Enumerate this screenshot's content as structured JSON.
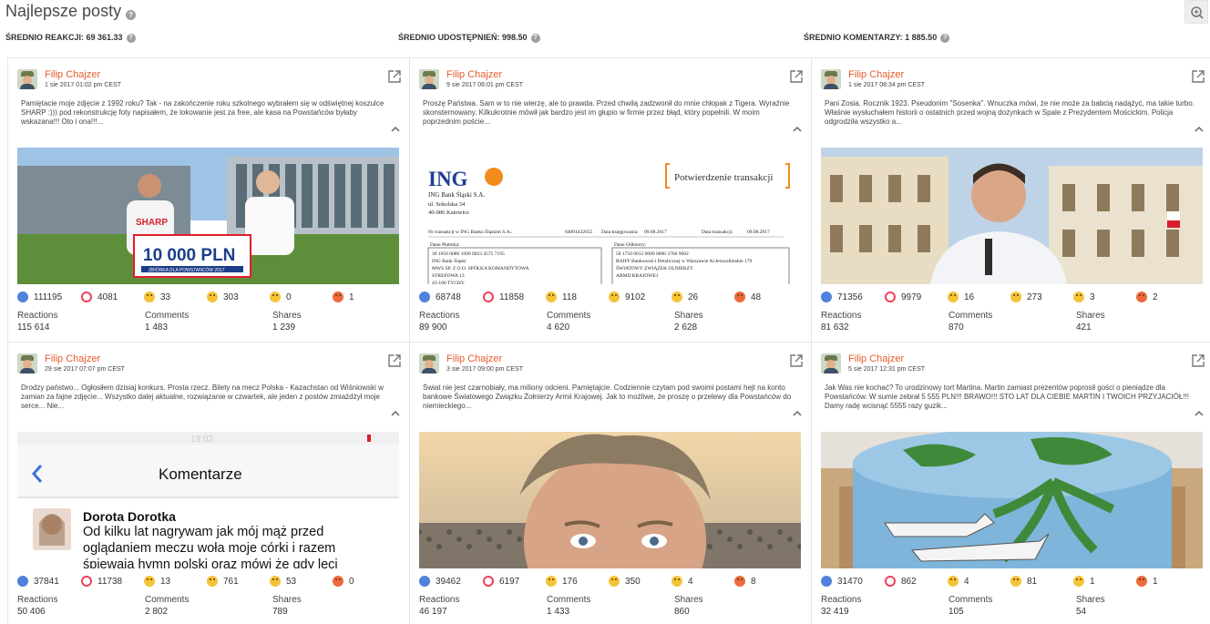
{
  "header": {
    "title": "Najlepsze posty"
  },
  "stats": {
    "avg_reactions": "ŚREDNIO REAKCJI: 69 361.33",
    "avg_shares": "ŚREDNIO UDOSTĘPNIEŃ: 998.50",
    "avg_comments": "ŚREDNIO KOMENTARZY: 1 885.50"
  },
  "labels": {
    "reactions": "Reactions",
    "comments": "Comments",
    "shares": "Shares"
  },
  "posts": [
    {
      "author": "Filip Chajzer",
      "date": "1 sie 2017 01:02 pm CEST",
      "text": "Pamiętacie moje zdjęcie z 1992 roku? Tak - na zakończenie roku szkolnego wybrałem się w odświętnej koszulce SHARP :))) pod rekonstrukcję foty napisałem, że lokowanie jest za free, ale kasa na Powstańców byłaby wskazana!!! Oto i ona!!!...",
      "media": "photo-check",
      "photo_text": {
        "brand": "SHARP",
        "amount": "10 000 PLN",
        "caption": "ZBIÓRKA DLA POWSTAŃCÓW 2017"
      },
      "reactions": {
        "like": "111195",
        "love": "4081",
        "haha": "33",
        "wow": "303",
        "sad": "0",
        "angry": "1"
      },
      "totals": {
        "reactions": "115 614",
        "comments": "1 483",
        "shares": "1 239"
      }
    },
    {
      "author": "Filip Chajzer",
      "date": "9 sie 2017 06:01 pm CEST",
      "text": "Proszę Państwa. Sam w to nie wierzę, ale to prawda. Przed chwilą zadzwonił do mnie chłopak z Tigera. Wyraźnie skonsternowany. Kilkukrotnie mówił jak bardzo jest im głupio w firmie przez błąd, który popełnili. W moim poprzednim poście...",
      "media": "document",
      "document": {
        "logo": "ING",
        "bank_name": "ING Bank Śląski S.A.",
        "address1": "ul. Sokolska 34",
        "address2": "40-086 Katowice",
        "heading": "Potwierdzenie transakcji",
        "line1": "Nr transakcji w ING Banku Śląskim S.A.:",
        "line1_val": "64001432655",
        "line1_date_label": "Data księgowania:",
        "line1_date": "09.08.2017",
        "line1_date2_label": "Data transakcji:",
        "line1_date2": "09.08.2017",
        "payer_label": "Dane Płatnika:",
        "payer_lines": [
          "39 1050 0086 1000 0023 4575 7195",
          "ING Bank Śląski",
          "MWS SP. Z O.O. SPÓŁKA KOMANDYTOWA",
          "STREFOWA 13",
          "43-100 TYCHY"
        ],
        "payee_label": "Dane Odbiorcy:",
        "payee_lines": [
          "50 1750 0012 0000 0000 3760 9692",
          "RAIFF Bankowości Detalicznej w Warszawie Al.Jerozolimskie 179",
          "ŚWIATOWY ZWIĄZEK    OLNIERZY",
          "ARMII KRAJOWEJ"
        ]
      },
      "reactions": {
        "like": "68748",
        "love": "11858",
        "haha": "118",
        "wow": "9102",
        "sad": "26",
        "angry": "48"
      },
      "totals": {
        "reactions": "89 900",
        "comments": "4 620",
        "shares": "2 628"
      }
    },
    {
      "author": "Filip Chajzer",
      "date": "1 sie 2017 08:34 pm CEST",
      "text": "Pani Zosia. Rocznik 1923. Pseudonim \"Sosenka\". Wnuczka mówi, że nie może za babcią nadążyć, ma takie turbo. Właśnie wysłuchałem historii o ostatnich przed wojną dożynkach w Spale z Prezydentem Mościckim. Policja odgrodziła wszystko a...",
      "media": "photo-palace",
      "reactions": {
        "like": "71356",
        "love": "9979",
        "haha": "16",
        "wow": "273",
        "sad": "3",
        "angry": "2"
      },
      "totals": {
        "reactions": "81 632",
        "comments": "870",
        "shares": "421"
      }
    },
    {
      "author": "Filip Chajzer",
      "date": "29 sie 2017 07:07 pm CEST",
      "text": "Drodzy państwo... Ogłosiłem dzisiaj konkurs. Prosta rzecz. Bilety na mecz Polska - Kazachstan od Wiśniowski w zamian za fajne zdjęcie... Wszystko dalej aktualne, rozwiązanie w czwartek, ale jeden z postów zmiażdżył moje serce... Nie...",
      "media": "screenshot-comments",
      "screenshot": {
        "time": "19:02",
        "title": "Komentarze",
        "commenter": "Dorota Dorotka",
        "comment": "Od kilku lat nagrywam jak mój mąż przed oglądaniem meczu woła moje córki i razem śpiewaja hymn polski oraz mówi że gdy leci"
      },
      "reactions": {
        "like": "37841",
        "love": "11738",
        "haha": "13",
        "wow": "761",
        "sad": "53",
        "angry": "0"
      },
      "totals": {
        "reactions": "50 406",
        "comments": "2 802",
        "shares": "789"
      }
    },
    {
      "author": "Filip Chajzer",
      "date": "3 sie 2017 09:00 pm CEST",
      "text": "Świat nie jest czarnobiały, ma miliony odcieni. Pamiętajcie. Codziennie czytam pod swoimi postami hejt na konto bankowe Światowego Związku Żołnierzy Armii Krajowej. Jak to możliwe, że proszę o przelewy dla Powstańców do niemieckiego...",
      "media": "photo-selfie",
      "reactions": {
        "like": "39462",
        "love": "6197",
        "haha": "176",
        "wow": "350",
        "sad": "4",
        "angry": "8"
      },
      "totals": {
        "reactions": "46 197",
        "comments": "1 433",
        "shares": "860"
      }
    },
    {
      "author": "Filip Chajzer",
      "date": "5 sie 2017 12:31 pm CEST",
      "text": "Jak Was nie kochać? To urodzinowy tort Martina. Martin zamiast prezentów poprosił gości o pieniądze dla Powstańców. W sumie zebrał 5 555 PLN!!! BRAWO!!! STO LAT DLA CIEBIE MARTIN I TWOICH PRZYJACIÓŁ!!! Damy radę wcisnąć 5555 razy guzik...",
      "media": "photo-cake",
      "reactions": {
        "like": "31470",
        "love": "862",
        "haha": "4",
        "wow": "81",
        "sad": "1",
        "angry": "1"
      },
      "totals": {
        "reactions": "32 419",
        "comments": "105",
        "shares": "54"
      }
    }
  ]
}
